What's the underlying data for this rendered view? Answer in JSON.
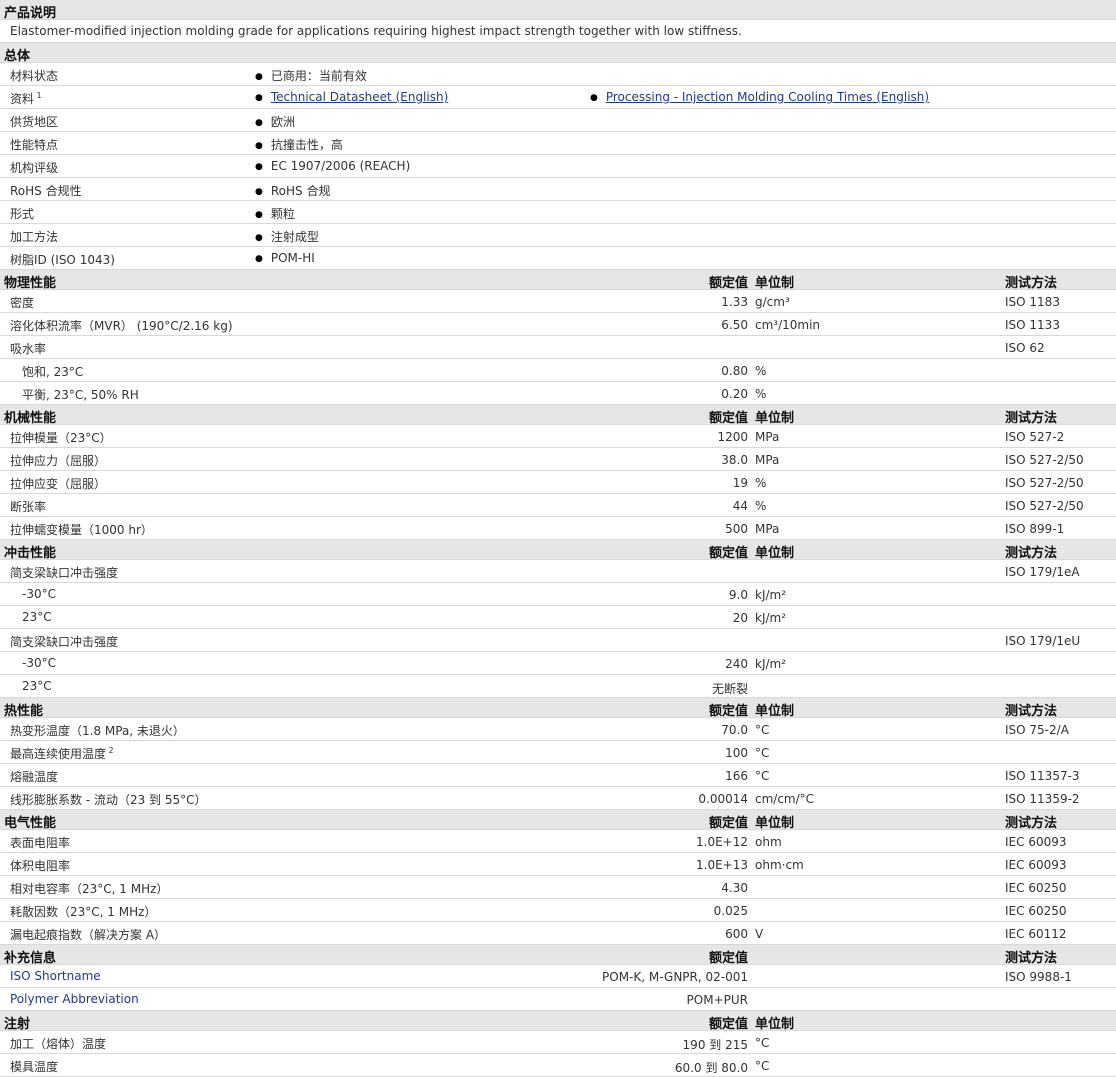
{
  "product_description": {
    "title": "产品说明",
    "text": "Elastomer-modified injection molding grade for applications requiring highest impact strength together with low stiffness."
  },
  "general": {
    "title": "总体",
    "rows": [
      {
        "label": "材料状态",
        "items": [
          "已商用：当前有效"
        ]
      },
      {
        "label": "资料",
        "sup": "1",
        "items": [
          "Technical Datasheet (English)",
          "Processing - Injection Molding Cooling Times (English)"
        ],
        "links": true
      },
      {
        "label": "供货地区",
        "items": [
          "欧洲"
        ]
      },
      {
        "label": "性能特点",
        "items": [
          "抗撞击性，高"
        ]
      },
      {
        "label": "机构评级",
        "items": [
          "EC 1907/2006 (REACH)"
        ]
      },
      {
        "label": "RoHS 合规性",
        "items": [
          "RoHS 合规"
        ]
      },
      {
        "label": "形式",
        "items": [
          "颗粒"
        ]
      },
      {
        "label": "加工方法",
        "items": [
          "注射成型"
        ]
      },
      {
        "label": "树脂ID (ISO 1043)",
        "items": [
          "POM-HI"
        ]
      }
    ]
  },
  "sections": [
    {
      "title": "物理性能",
      "col_value": "额定值",
      "col_unit": "单位制",
      "col_method": "测试方法",
      "rows": [
        {
          "label": "密度",
          "value": "1.33",
          "unit": "g/cm³",
          "method": "ISO 1183"
        },
        {
          "label": "溶化体积流率（MVR） (190°C/2.16 kg)",
          "value": "6.50",
          "unit": "cm³/10min",
          "method": "ISO 1133"
        },
        {
          "label": "吸水率",
          "value": "",
          "unit": "",
          "method": "ISO 62"
        },
        {
          "label": "饱和, 23°C",
          "value": "0.80",
          "unit": "%",
          "method": "",
          "sub": true
        },
        {
          "label": "平衡, 23°C, 50% RH",
          "value": "0.20",
          "unit": "%",
          "method": "",
          "sub": true
        }
      ]
    },
    {
      "title": "机械性能",
      "col_value": "额定值",
      "col_unit": "单位制",
      "col_method": "测试方法",
      "rows": [
        {
          "label": "拉伸模量（23°C）",
          "value": "1200",
          "unit": "MPa",
          "method": "ISO 527-2"
        },
        {
          "label": "拉伸应力（屈服）",
          "value": "38.0",
          "unit": "MPa",
          "method": "ISO 527-2/50"
        },
        {
          "label": "拉伸应变（屈服）",
          "value": "19",
          "unit": "%",
          "method": "ISO 527-2/50"
        },
        {
          "label": "断张率",
          "value": "44",
          "unit": "%",
          "method": "ISO 527-2/50"
        },
        {
          "label": "拉伸蠕变模量（1000 hr）",
          "value": "500",
          "unit": "MPa",
          "method": "ISO 899-1"
        }
      ]
    },
    {
      "title": "冲击性能",
      "col_value": "额定值",
      "col_unit": "单位制",
      "col_method": "测试方法",
      "rows": [
        {
          "label": "简支梁缺口冲击强度",
          "value": "",
          "unit": "",
          "method": "ISO 179/1eA"
        },
        {
          "label": "-30°C",
          "value": "9.0",
          "unit": "kJ/m²",
          "method": "",
          "sub": true
        },
        {
          "label": "23°C",
          "value": "20",
          "unit": "kJ/m²",
          "method": "",
          "sub": true
        },
        {
          "label": "简支梁缺口冲击强度",
          "value": "",
          "unit": "",
          "method": "ISO 179/1eU"
        },
        {
          "label": "-30°C",
          "value": "240",
          "unit": "kJ/m²",
          "method": "",
          "sub": true
        },
        {
          "label": "23°C",
          "value": "无断裂",
          "unit": "",
          "method": "",
          "sub": true
        }
      ]
    },
    {
      "title": "热性能",
      "col_value": "额定值",
      "col_unit": "单位制",
      "col_method": "测试方法",
      "rows": [
        {
          "label": "热变形温度（1.8 MPa, 未退火）",
          "value": "70.0",
          "unit": "°C",
          "method": "ISO 75-2/A"
        },
        {
          "label": "最高连续使用温度",
          "sup": "2",
          "value": "100",
          "unit": "°C",
          "method": ""
        },
        {
          "label": "熔融温度",
          "value": "166",
          "unit": "°C",
          "method": "ISO 11357-3"
        },
        {
          "label": "线形膨胀系数 - 流动（23 到 55°C）",
          "value": "0.00014",
          "unit": "cm/cm/°C",
          "method": "ISO 11359-2"
        }
      ]
    },
    {
      "title": "电气性能",
      "col_value": "额定值",
      "col_unit": "单位制",
      "col_method": "测试方法",
      "rows": [
        {
          "label": "表面电阻率",
          "value": "1.0E+12",
          "unit": "ohm",
          "method": "IEC 60093"
        },
        {
          "label": "体积电阻率",
          "value": "1.0E+13",
          "unit": "ohm·cm",
          "method": "IEC 60093"
        },
        {
          "label": "相对电容率（23°C, 1 MHz）",
          "value": "4.30",
          "unit": "",
          "method": "IEC 60250"
        },
        {
          "label": "耗散因数（23°C, 1 MHz）",
          "value": "0.025",
          "unit": "",
          "method": "IEC 60250"
        },
        {
          "label": "漏电起痕指数（解决方案 A）",
          "value": "600",
          "unit": "V",
          "method": "IEC 60112"
        }
      ]
    },
    {
      "title": "补充信息",
      "col_value": "额定值",
      "col_unit": "",
      "col_method": "测试方法",
      "rows": [
        {
          "label": "ISO Shortname",
          "value": "POM-K, M-GNPR, 02-001",
          "unit": "",
          "method": "ISO 9988-1",
          "link": true
        },
        {
          "label": "Polymer Abbreviation",
          "value": "POM+PUR",
          "unit": "",
          "method": "",
          "link": true
        }
      ]
    },
    {
      "title": "注射",
      "col_value": "额定值",
      "col_unit": "单位制",
      "col_method": "",
      "rows": [
        {
          "label": "加工（熔体）温度",
          "value": "190 到 215",
          "unit": "°C",
          "method": ""
        },
        {
          "label": "模具温度",
          "value": "60.0 到 80.0",
          "unit": "°C",
          "method": ""
        }
      ]
    }
  ]
}
